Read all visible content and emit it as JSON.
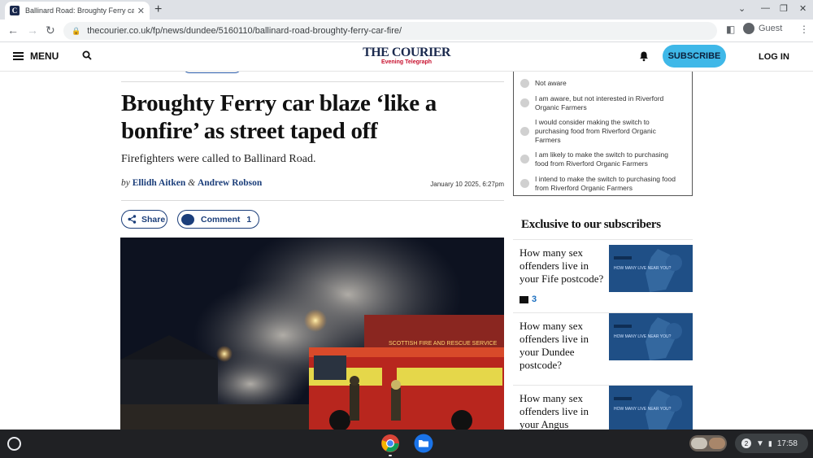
{
  "browser": {
    "tab_title": "Ballinard Road: Broughty Ferry car fire",
    "favicon_letter": "C",
    "url": "thecourier.co.uk/fp/news/dundee/5160110/ballinard-road-broughty-ferry-car-fire/",
    "profile_label": "Guest"
  },
  "site": {
    "menu_label": "MENU",
    "logo_main": "THE COURIER",
    "logo_sub": "Evening Telegraph",
    "subscribe_label": "SUBSCRIBE",
    "login_label": "LOG IN"
  },
  "article": {
    "headline": "Broughty Ferry car blaze ‘like a bonfire’ as street taped off",
    "standfirst": "Firefighters were called to Ballinard Road.",
    "by_word": "by",
    "author1": "Ellidh Aitken",
    "amp": "&",
    "author2": "Andrew Robson",
    "date": "January 10 2025, 6:27pm",
    "share_label": "Share",
    "comment_label": "Comment",
    "comment_count": "1",
    "hero_truck_text": "SCOTTISH FIRE AND RESCUE SERVICE"
  },
  "poll": {
    "options": [
      "Not aware",
      "I am aware, but not interested in Riverford Organic Farmers",
      "I would consider making the switch to purchasing food from Riverford Organic Farmers",
      "I am likely to make the switch to purchasing food from Riverford Organic Farmers",
      "I intend to make the switch to purchasing food from Riverford Organic Farmers"
    ]
  },
  "sidebar": {
    "heading": "Exclusive to our subscribers",
    "cards": [
      {
        "title": "How many sex offenders live in your Fife postcode?",
        "comments": "3",
        "thumb_text": "HOW MANY LIVE NEAR YOU?"
      },
      {
        "title": "How many sex offenders live in your Dundee postcode?",
        "comments": "",
        "thumb_text": "HOW MANY LIVE NEAR YOU?"
      },
      {
        "title": "How many sex offenders live in your Angus",
        "comments": "",
        "thumb_text": "HOW MANY LIVE NEAR YOU?"
      }
    ]
  },
  "shelf": {
    "notification_count": "2",
    "time": "17:58"
  },
  "colors": {
    "brand_navy": "#1b2a4e",
    "link_blue": "#1b3e7a",
    "subscribe_cyan": "#3fb8e8"
  }
}
